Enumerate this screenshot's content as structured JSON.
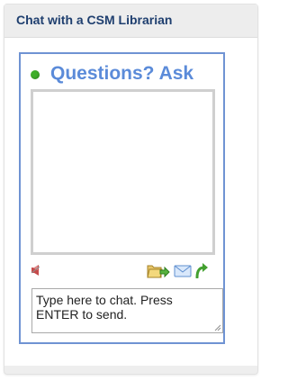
{
  "panel": {
    "title": "Chat with a CSM Librarian"
  },
  "widget": {
    "status": "online",
    "heading": "Questions? Ask",
    "input": {
      "value": "",
      "placeholder": "Type here to chat. Press ENTER to send."
    },
    "icons": {
      "sound": "speaker-icon",
      "file": "file-transfer-icon",
      "email": "email-transcript-icon",
      "popout": "popout-arrow-icon"
    }
  },
  "colors": {
    "title": "#1f3f6f",
    "heading": "#5b8bd9",
    "widget_border": "#6f93d3",
    "status_online": "#3fae2a"
  }
}
